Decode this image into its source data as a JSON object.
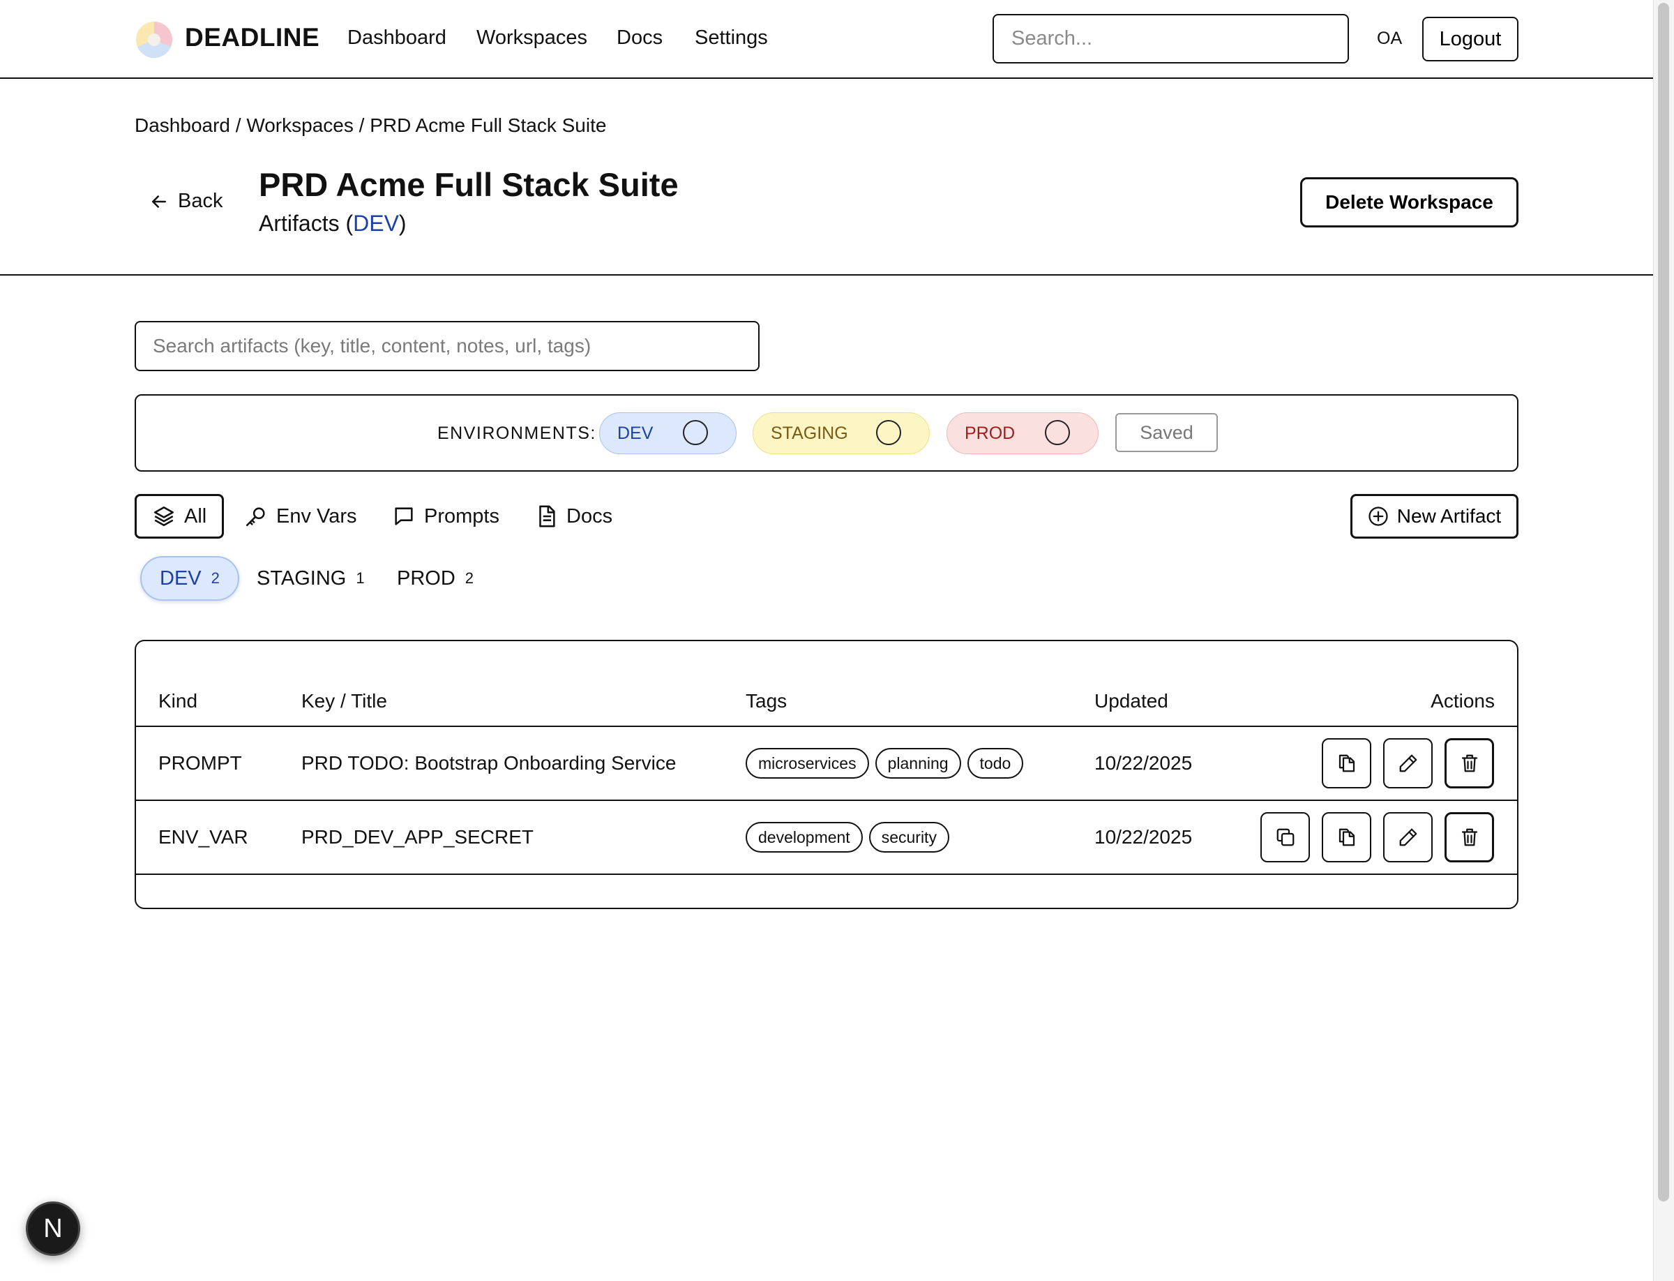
{
  "app": {
    "brand": "DEADLINE"
  },
  "nav": {
    "items": [
      "Dashboard",
      "Workspaces",
      "Docs",
      "Settings"
    ]
  },
  "topbar": {
    "search_placeholder": "Search...",
    "user_initials": "OA",
    "logout_label": "Logout"
  },
  "breadcrumb": "Dashboard / Workspaces / PRD Acme Full Stack Suite",
  "header": {
    "back_label": "Back",
    "title": "PRD Acme Full Stack Suite",
    "subtitle_prefix": "Artifacts (",
    "subtitle_env": "DEV",
    "subtitle_suffix": ")",
    "delete_label": "Delete Workspace"
  },
  "search": {
    "placeholder": "Search artifacts (key, title, content, notes, url, tags)"
  },
  "environments": {
    "label": "ENVIRONMENTS:",
    "pills": [
      {
        "label": "DEV",
        "color": "#1d3fa8"
      },
      {
        "label": "STAGING",
        "color": "#7a5a12"
      },
      {
        "label": "PROD",
        "color": "#a31d1d"
      }
    ],
    "saved_label": "Saved"
  },
  "kind_tabs": [
    {
      "label": "All",
      "icon": "layers-icon",
      "active": true
    },
    {
      "label": "Env Vars",
      "icon": "key-icon"
    },
    {
      "label": "Prompts",
      "icon": "message-icon"
    },
    {
      "label": "Docs",
      "icon": "document-icon"
    }
  ],
  "new_artifact_label": "New Artifact",
  "env_filters": [
    {
      "label": "DEV",
      "count": "2",
      "active": true
    },
    {
      "label": "STAGING",
      "count": "1"
    },
    {
      "label": "PROD",
      "count": "2"
    }
  ],
  "table": {
    "columns": [
      "Kind",
      "Key / Title",
      "Tags",
      "Updated",
      "Actions"
    ],
    "rows": [
      {
        "kind": "PROMPT",
        "title": "PRD TODO: Bootstrap Onboarding Service",
        "tags": [
          "microservices",
          "planning",
          "todo"
        ],
        "updated": "10/22/2025",
        "actions": [
          "duplicate-icon",
          "edit-icon",
          "trash-icon"
        ]
      },
      {
        "kind": "ENV_VAR",
        "title": "PRD_DEV_APP_SECRET",
        "tags": [
          "development",
          "security"
        ],
        "updated": "10/22/2025",
        "actions": [
          "copy-icon",
          "duplicate-icon",
          "edit-icon",
          "trash-icon"
        ]
      }
    ]
  },
  "dev_badge": "N"
}
